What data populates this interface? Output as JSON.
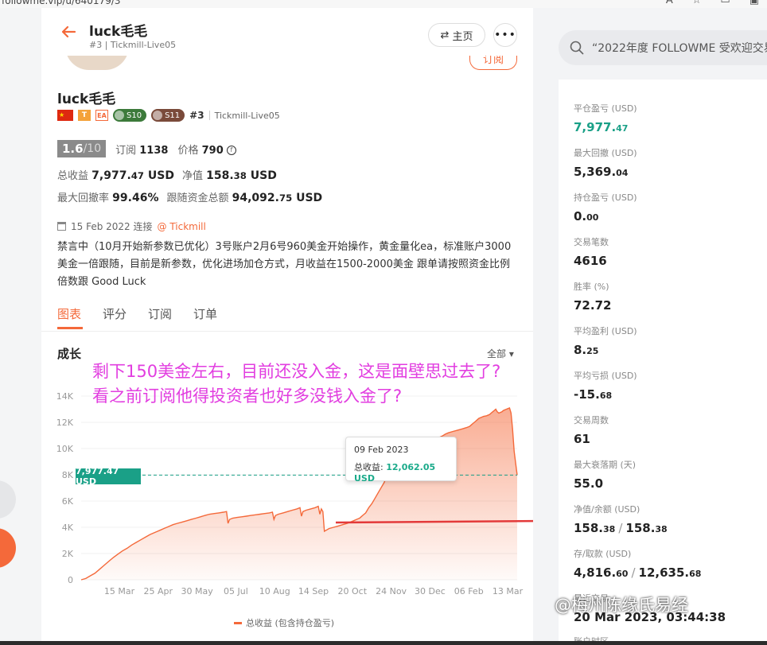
{
  "browser": {
    "url": "followme.vip/u/640179/3"
  },
  "header": {
    "name": "luck毛毛",
    "sub": "#3 | Tickmill-Live05",
    "home_label": "主页",
    "more_label": "•••",
    "subscribe_label": "订阅"
  },
  "profile": {
    "name": "luck毛毛",
    "flag": "★",
    "badge_t": "T",
    "badge_ea": "EA",
    "badge_s10": "S10",
    "badge_s11": "S11",
    "rank": "#3",
    "account": "Tickmill-Live05",
    "score": "1.6",
    "score_max": "/10",
    "subs_label": "订阅",
    "subs_value": "1138",
    "price_label": "价格",
    "price_value": "790",
    "total_profit_label": "总收益",
    "total_profit_int": "7,977.",
    "total_profit_dec": "47",
    "total_profit_unit": " USD",
    "equity_label": "净值",
    "equity_int": "158.",
    "equity_dec": "38",
    "equity_unit": " USD",
    "drawdown_label": "最大回撤率",
    "drawdown_value": "99.46%",
    "follow_label": "跟随资金总额",
    "follow_int": "94,092.",
    "follow_dec": "75",
    "follow_unit": " USD",
    "date": "15 Feb 2022 连接",
    "broker": "@ Tickmill",
    "description": "禁言中（10月开始新参数已优化）3号账户2月6号960美金开始操作，黄金量化ea，标准账户3000美金一倍跟随，目前是新参数，优化进场加仓方式，月收益在1500-2000美金  跟单请按照资金比例倍数跟   Good Luck"
  },
  "tabs": [
    {
      "label": "图表"
    },
    {
      "label": "评分"
    },
    {
      "label": "订阅"
    },
    {
      "label": "订单"
    }
  ],
  "chart_section": {
    "title": "成长",
    "range_label": "全部 ▾"
  },
  "annotation": {
    "line1": "剩下150美金左右，目前还没入金，这是面壁思过去了?",
    "line2": "看之前订阅他得投资者也好多没钱入金了?"
  },
  "tooltip": {
    "date": "09 Feb 2023",
    "label": "总收益: ",
    "value": "12,062.05 USD"
  },
  "current_tag": "7,977.47 USD",
  "chart_data": {
    "type": "area",
    "title": "",
    "legend": "总收益 (包含持仓盈亏)",
    "yticks": [
      "0",
      "2K",
      "4K",
      "6K",
      "8K",
      "10K",
      "12K",
      "14K"
    ],
    "ylim": [
      0,
      14000
    ],
    "xticks": [
      "15 Mar",
      "25 Apr",
      "30 May",
      "05 Jul",
      "10 Aug",
      "14 Sep",
      "20 Oct",
      "24 Nov",
      "30 Dec",
      "06 Feb",
      "13 Mar"
    ],
    "reference_value": 7977.47,
    "grid": true,
    "series": [
      {
        "name": "总收益 (包含持仓盈亏)",
        "color": "#f4693a",
        "x": [
          0,
          6,
          12,
          18,
          24,
          30,
          36,
          42,
          48,
          54,
          60,
          66,
          72,
          78,
          84,
          90,
          96,
          100,
          104,
          108,
          112,
          116,
          120,
          126,
          132,
          138,
          144,
          150,
          156,
          162,
          168,
          174,
          180,
          186,
          190,
          192,
          194,
          198,
          204,
          210,
          216,
          222,
          228,
          234,
          240,
          246,
          250,
          252,
          254,
          258,
          264,
          270,
          276,
          282,
          286,
          288,
          290,
          294,
          300,
          306,
          310,
          312,
          314,
          316,
          318,
          324,
          330,
          336,
          342,
          348,
          352,
          356,
          360,
          364,
          366,
          368,
          370,
          372,
          374,
          376,
          380,
          384,
          390,
          396,
          402,
          408,
          414,
          420,
          426,
          432,
          436,
          440,
          442,
          444,
          446,
          448,
          450,
          452,
          456,
          460,
          462,
          464,
          466,
          468,
          470,
          472,
          476,
          480,
          486,
          492,
          498,
          504,
          508,
          510,
          512,
          514,
          516,
          518,
          520,
          522,
          524,
          526,
          530,
          534,
          536,
          538,
          540,
          542,
          544,
          546,
          548,
          550,
          552,
          554,
          556,
          558,
          560,
          562,
          564,
          566,
          570
        ],
        "values": [
          0,
          100,
          300,
          500,
          800,
          1100,
          1400,
          1700,
          1950,
          2200,
          2400,
          2650,
          2850,
          3050,
          3250,
          3450,
          3600,
          3700,
          3800,
          3900,
          4000,
          4100,
          4200,
          4300,
          4400,
          4500,
          4600,
          4700,
          4800,
          4900,
          5000,
          5050,
          5100,
          5150,
          5200,
          4300,
          4600,
          4700,
          4750,
          4800,
          4850,
          4900,
          4950,
          5000,
          5050,
          5100,
          5150,
          4600,
          4900,
          5000,
          5100,
          5200,
          5300,
          5400,
          5500,
          4850,
          5200,
          5300,
          5400,
          5500,
          5600,
          5000,
          5400,
          5200,
          3700,
          3900,
          4000,
          4100,
          4200,
          4300,
          4400,
          4500,
          4600,
          4700,
          4800,
          4900,
          5000,
          5100,
          5300,
          5500,
          5800,
          6200,
          6800,
          7400,
          8200,
          8900,
          9300,
          9500,
          9700,
          9900,
          10100,
          10250,
          10300,
          10350,
          10400,
          10450,
          10500,
          10550,
          10600,
          10650,
          10700,
          10750,
          10800,
          10850,
          10900,
          10950,
          11100,
          11200,
          11300,
          11400,
          11500,
          11600,
          11700,
          11800,
          11900,
          12000,
          12100,
          12200,
          12300,
          12350,
          12400,
          12450,
          12500,
          12600,
          12700,
          12800,
          12900,
          13000,
          12800,
          12700,
          12750,
          12800,
          12900,
          12950,
          13000,
          13050,
          13100,
          12700,
          11500,
          9800,
          7977
        ]
      }
    ]
  },
  "search": {
    "placeholder": "“2022年度 FOLLOWME 受欢迎交易"
  },
  "right_stats": [
    {
      "label": "平仓盈亏 (USD)",
      "int": "7,977.",
      "dec": "47",
      "green": true
    },
    {
      "label": "最大回撤 (USD)",
      "int": "5,369.",
      "dec": "04"
    },
    {
      "label": "持仓盈亏 (USD)",
      "int": "0.",
      "dec": "00"
    },
    {
      "label": "交易笔数",
      "int": "4616",
      "dec": ""
    },
    {
      "label": "胜率 (%)",
      "int": "72.72",
      "dec": ""
    },
    {
      "label": "平均盈利 (USD)",
      "int": "8.",
      "dec": "25"
    },
    {
      "label": "平均亏损 (USD)",
      "int": "-15.",
      "dec": "68"
    },
    {
      "label": "交易周数",
      "int": "61",
      "dec": ""
    },
    {
      "label": "最大衰落期 (天)",
      "int": "55.0",
      "dec": ""
    }
  ],
  "right_pairs": [
    {
      "label": "净值/余额 (USD)",
      "a_int": "158.",
      "a_dec": "38",
      "slash": "/",
      "b_int": "158.",
      "b_dec": "38"
    },
    {
      "label": "存/取款 (USD)",
      "a_int": "4,816.",
      "a_dec": "60",
      "slash": "/",
      "b_int": "12,635.",
      "b_dec": "68"
    }
  ],
  "right_last": {
    "label": "最近交易",
    "value": "20 Mar 2023, 03:44:38"
  },
  "right_account_label": "账户时区",
  "watermark": "@梅州陈缘氏易经"
}
